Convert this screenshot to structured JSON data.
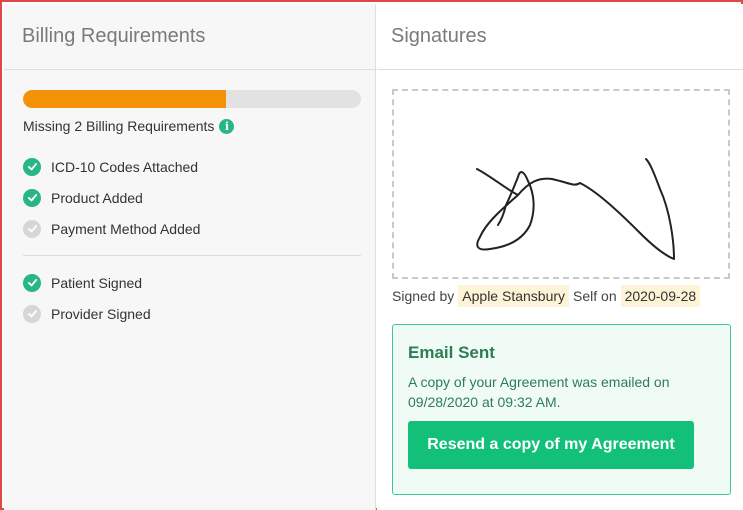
{
  "billing": {
    "title": "Billing Requirements",
    "progress_fraction": 0.6,
    "missing_text": "Missing 2 Billing Requirements",
    "requirements": [
      {
        "label": "ICD-10 Codes Attached",
        "done": true
      },
      {
        "label": "Product Added",
        "done": true
      },
      {
        "label": "Payment Method Added",
        "done": false
      }
    ],
    "signatures_status": [
      {
        "label": "Patient Signed",
        "done": true
      },
      {
        "label": "Provider Signed",
        "done": false
      }
    ],
    "colors": {
      "progress": "#f39207",
      "check_done": "#27b684",
      "check_pending": "#d6d6d6"
    }
  },
  "signatures": {
    "title": "Signatures",
    "signed_by_prefix": "Signed by",
    "signer_name": "Apple Stansbury",
    "signer_role": "Self on",
    "signed_date": "2020-09-28"
  },
  "email": {
    "title": "Email Sent",
    "message": "A copy of your Agreement was emailed on 09/28/2020 at 09:32 AM.",
    "resend_label": "Resend a copy of my Agreement",
    "colors": {
      "button": "#13c07a",
      "card_border": "#3ec894"
    }
  },
  "icons": {
    "info": "info-icon",
    "check": "check-icon"
  }
}
